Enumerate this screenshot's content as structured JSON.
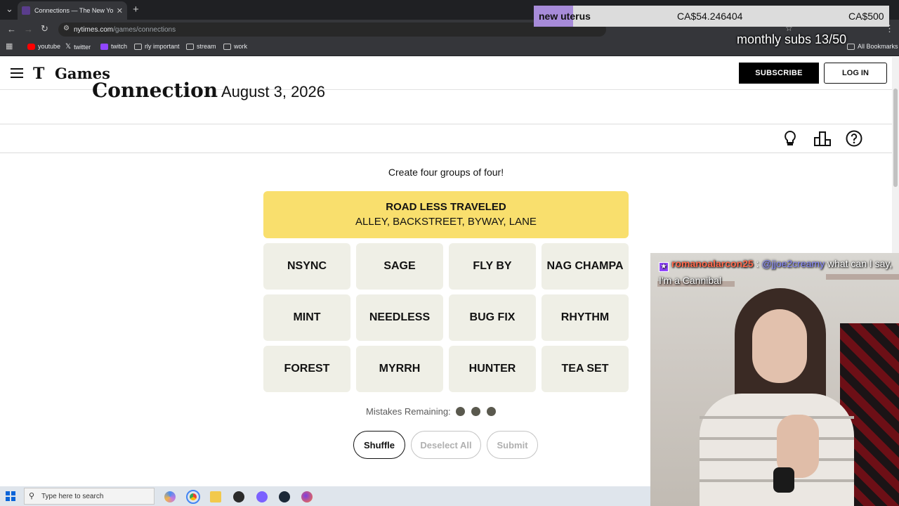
{
  "browser": {
    "tab_title": "Connections — The New York T",
    "url_host": "nytimes.com",
    "url_path": "/games/connections",
    "bookmarks": [
      "youtube",
      "twitter",
      "twitch",
      "rly important",
      "stream",
      "work"
    ],
    "all_bookmarks": "All Bookmarks"
  },
  "overlay": {
    "donor": "new uterus",
    "amount_current": "CA$54.246404",
    "amount_goal": "CA$500",
    "subs": "monthly subs 13/50"
  },
  "header": {
    "logo_t": "T",
    "logo_games": "Games",
    "subscribe": "SUBSCRIBE",
    "login": "LOG IN"
  },
  "game": {
    "title": "Connections",
    "date": "August 3, 2026",
    "instructions": "Create four groups of four!",
    "solved": {
      "title": "ROAD LESS TRAVELED",
      "members": "ALLEY, BACKSTREET, BYWAY, LANE",
      "color": "#f9df6d"
    },
    "words": [
      "NSYNC",
      "SAGE",
      "FLY BY",
      "NAG CHAMPA",
      "MINT",
      "NEEDLESS",
      "BUG FIX",
      "RHYTHM",
      "FOREST",
      "MYRRH",
      "HUNTER",
      "TEA SET"
    ],
    "mistakes_label": "Mistakes Remaining:",
    "mistakes_remaining": 3,
    "buttons": {
      "shuffle": "Shuffle",
      "deselect": "Deselect All",
      "submit": "Submit"
    }
  },
  "chat": {
    "username": "romanoalarcon25",
    "separator": ":",
    "mention": "@jjoe2creamy",
    "message": "what can I say, I'm a Cannibal"
  },
  "taskbar": {
    "search_placeholder": "Type here to search"
  }
}
